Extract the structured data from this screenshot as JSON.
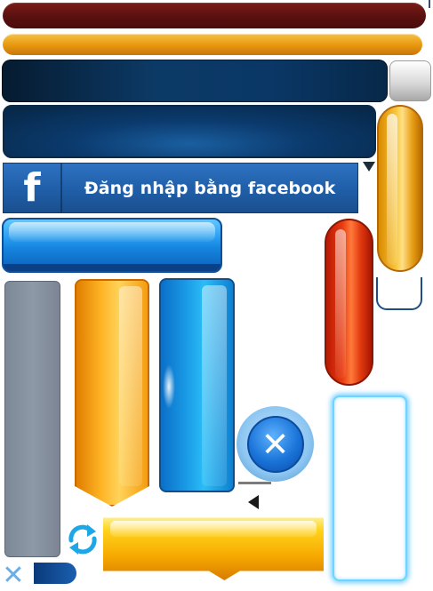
{
  "facebook_login": {
    "icon": "facebook-f-icon",
    "logo_letter": "f",
    "label": "Đăng nhập bằng facebook",
    "color": "#2060aa"
  },
  "icons": {
    "close": "close-icon",
    "refresh": "refresh-icon",
    "small_close": "close-icon",
    "close_glyph": "✕",
    "small_close_glyph": "✕"
  },
  "colors": {
    "dark_red_bar": "#5a1010",
    "orange_bar": "#e89a10",
    "navy_bar": "#0c3a66",
    "blue_button": "#1585e0",
    "orange_pill": "#f8c53a",
    "red_pill": "#e83a10",
    "gray_card": "#8e99a8",
    "cyan_glow": "#6fd4ff",
    "yellow_banner": "#ffd21a"
  }
}
